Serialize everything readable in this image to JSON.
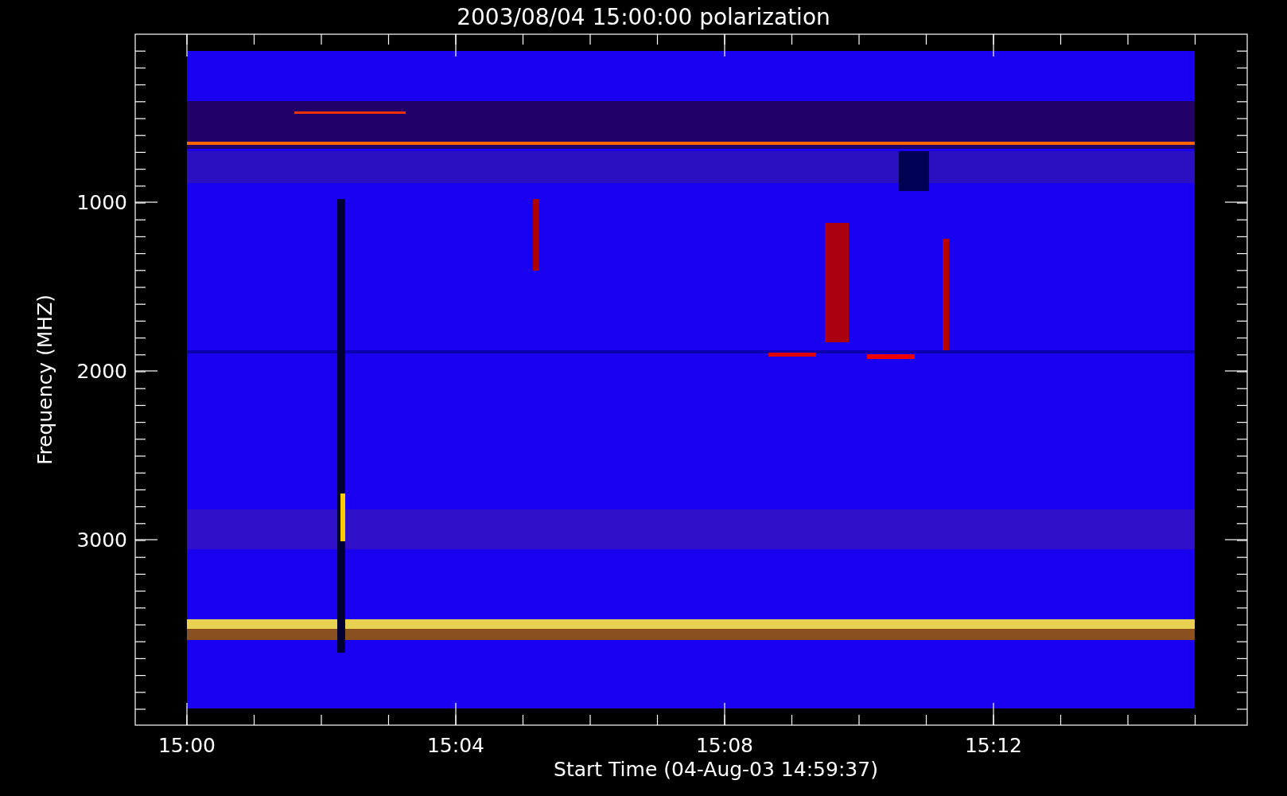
{
  "plot": {
    "title": "2003/08/04 15:00:00 polarization",
    "ylabel": "Frequency (MHZ)",
    "xlabel": "Start Time (04-Aug-03 14:59:37)",
    "yticks": [
      "1000",
      "2000",
      "3000"
    ],
    "xticks": [
      "15:00",
      "15:04",
      "15:08",
      "15:12"
    ]
  }
}
